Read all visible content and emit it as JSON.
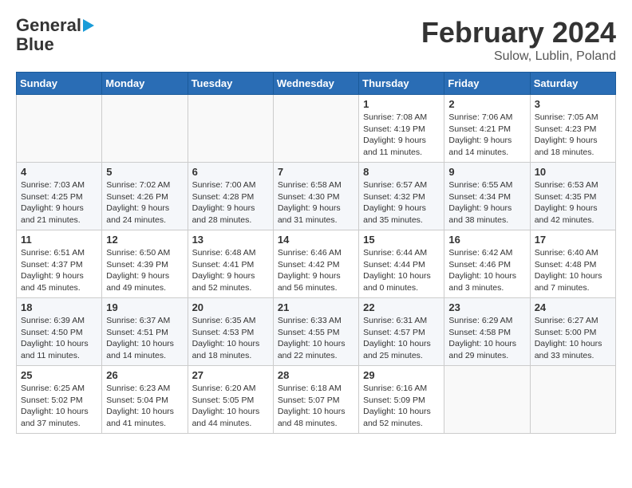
{
  "logo": {
    "line1": "General",
    "line2": "Blue"
  },
  "title": "February 2024",
  "location": "Sulow, Lublin, Poland",
  "days_header": [
    "Sunday",
    "Monday",
    "Tuesday",
    "Wednesday",
    "Thursday",
    "Friday",
    "Saturday"
  ],
  "weeks": [
    [
      {
        "day": "",
        "info": ""
      },
      {
        "day": "",
        "info": ""
      },
      {
        "day": "",
        "info": ""
      },
      {
        "day": "",
        "info": ""
      },
      {
        "day": "1",
        "info": "Sunrise: 7:08 AM\nSunset: 4:19 PM\nDaylight: 9 hours\nand 11 minutes."
      },
      {
        "day": "2",
        "info": "Sunrise: 7:06 AM\nSunset: 4:21 PM\nDaylight: 9 hours\nand 14 minutes."
      },
      {
        "day": "3",
        "info": "Sunrise: 7:05 AM\nSunset: 4:23 PM\nDaylight: 9 hours\nand 18 minutes."
      }
    ],
    [
      {
        "day": "4",
        "info": "Sunrise: 7:03 AM\nSunset: 4:25 PM\nDaylight: 9 hours\nand 21 minutes."
      },
      {
        "day": "5",
        "info": "Sunrise: 7:02 AM\nSunset: 4:26 PM\nDaylight: 9 hours\nand 24 minutes."
      },
      {
        "day": "6",
        "info": "Sunrise: 7:00 AM\nSunset: 4:28 PM\nDaylight: 9 hours\nand 28 minutes."
      },
      {
        "day": "7",
        "info": "Sunrise: 6:58 AM\nSunset: 4:30 PM\nDaylight: 9 hours\nand 31 minutes."
      },
      {
        "day": "8",
        "info": "Sunrise: 6:57 AM\nSunset: 4:32 PM\nDaylight: 9 hours\nand 35 minutes."
      },
      {
        "day": "9",
        "info": "Sunrise: 6:55 AM\nSunset: 4:34 PM\nDaylight: 9 hours\nand 38 minutes."
      },
      {
        "day": "10",
        "info": "Sunrise: 6:53 AM\nSunset: 4:35 PM\nDaylight: 9 hours\nand 42 minutes."
      }
    ],
    [
      {
        "day": "11",
        "info": "Sunrise: 6:51 AM\nSunset: 4:37 PM\nDaylight: 9 hours\nand 45 minutes."
      },
      {
        "day": "12",
        "info": "Sunrise: 6:50 AM\nSunset: 4:39 PM\nDaylight: 9 hours\nand 49 minutes."
      },
      {
        "day": "13",
        "info": "Sunrise: 6:48 AM\nSunset: 4:41 PM\nDaylight: 9 hours\nand 52 minutes."
      },
      {
        "day": "14",
        "info": "Sunrise: 6:46 AM\nSunset: 4:42 PM\nDaylight: 9 hours\nand 56 minutes."
      },
      {
        "day": "15",
        "info": "Sunrise: 6:44 AM\nSunset: 4:44 PM\nDaylight: 10 hours\nand 0 minutes."
      },
      {
        "day": "16",
        "info": "Sunrise: 6:42 AM\nSunset: 4:46 PM\nDaylight: 10 hours\nand 3 minutes."
      },
      {
        "day": "17",
        "info": "Sunrise: 6:40 AM\nSunset: 4:48 PM\nDaylight: 10 hours\nand 7 minutes."
      }
    ],
    [
      {
        "day": "18",
        "info": "Sunrise: 6:39 AM\nSunset: 4:50 PM\nDaylight: 10 hours\nand 11 minutes."
      },
      {
        "day": "19",
        "info": "Sunrise: 6:37 AM\nSunset: 4:51 PM\nDaylight: 10 hours\nand 14 minutes."
      },
      {
        "day": "20",
        "info": "Sunrise: 6:35 AM\nSunset: 4:53 PM\nDaylight: 10 hours\nand 18 minutes."
      },
      {
        "day": "21",
        "info": "Sunrise: 6:33 AM\nSunset: 4:55 PM\nDaylight: 10 hours\nand 22 minutes."
      },
      {
        "day": "22",
        "info": "Sunrise: 6:31 AM\nSunset: 4:57 PM\nDaylight: 10 hours\nand 25 minutes."
      },
      {
        "day": "23",
        "info": "Sunrise: 6:29 AM\nSunset: 4:58 PM\nDaylight: 10 hours\nand 29 minutes."
      },
      {
        "day": "24",
        "info": "Sunrise: 6:27 AM\nSunset: 5:00 PM\nDaylight: 10 hours\nand 33 minutes."
      }
    ],
    [
      {
        "day": "25",
        "info": "Sunrise: 6:25 AM\nSunset: 5:02 PM\nDaylight: 10 hours\nand 37 minutes."
      },
      {
        "day": "26",
        "info": "Sunrise: 6:23 AM\nSunset: 5:04 PM\nDaylight: 10 hours\nand 41 minutes."
      },
      {
        "day": "27",
        "info": "Sunrise: 6:20 AM\nSunset: 5:05 PM\nDaylight: 10 hours\nand 44 minutes."
      },
      {
        "day": "28",
        "info": "Sunrise: 6:18 AM\nSunset: 5:07 PM\nDaylight: 10 hours\nand 48 minutes."
      },
      {
        "day": "29",
        "info": "Sunrise: 6:16 AM\nSunset: 5:09 PM\nDaylight: 10 hours\nand 52 minutes."
      },
      {
        "day": "",
        "info": ""
      },
      {
        "day": "",
        "info": ""
      }
    ]
  ]
}
